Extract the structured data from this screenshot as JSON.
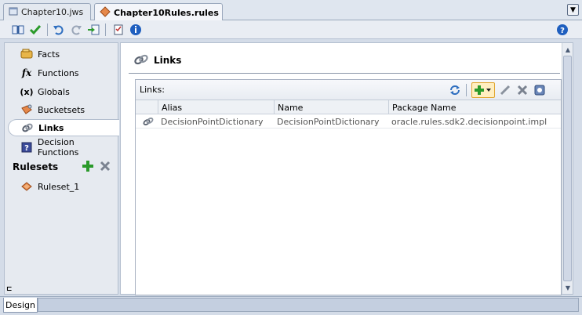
{
  "tabs": [
    {
      "label": "Chapter10.jws",
      "active": false
    },
    {
      "label": "Chapter10Rules.rules",
      "active": true
    }
  ],
  "nav": {
    "items": [
      {
        "label": "Facts",
        "icon": "facts-icon"
      },
      {
        "label": "Functions",
        "icon": "functions-icon"
      },
      {
        "label": "Globals",
        "icon": "globals-icon"
      },
      {
        "label": "Bucketsets",
        "icon": "bucketsets-icon"
      },
      {
        "label": "Links",
        "icon": "link-icon",
        "selected": true
      },
      {
        "label": "Decision Functions",
        "icon": "decision-functions-icon"
      }
    ],
    "fx_glyph": "fx",
    "globals_glyph": "(x)",
    "rulesets_label": "Rulesets",
    "rulesets": [
      {
        "label": "Ruleset_1"
      }
    ]
  },
  "main": {
    "title": "Links",
    "table_label": "Links:",
    "columns": [
      "Alias",
      "Name",
      "Package Name"
    ],
    "rows": [
      {
        "alias": "DecisionPointDictionary",
        "name": "DecisionPointDictionary",
        "package": "oracle.rules.sdk2.decisionpoint.impl"
      }
    ]
  },
  "bottom": {
    "design_tab": "Design",
    "collapse_glyph": "⊏"
  },
  "colors": {
    "accent_selected_border": "#e0a630",
    "help_blue": "#1f5fbf",
    "add_green": "#2a9a2a"
  }
}
